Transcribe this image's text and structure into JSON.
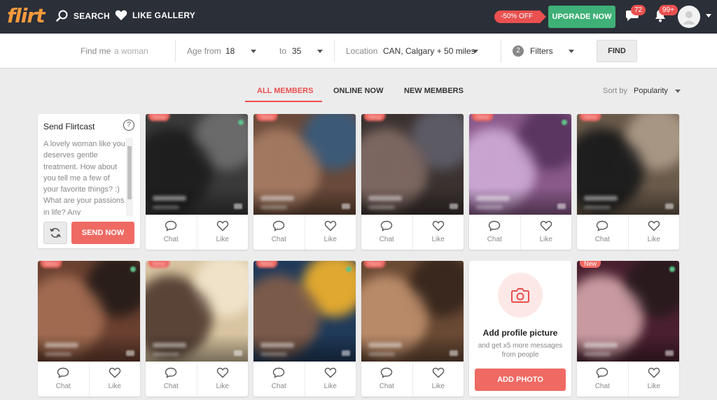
{
  "header": {
    "logo_text": "flirt",
    "nav": [
      {
        "label": "SEARCH",
        "icon": "search-icon"
      },
      {
        "label": "LIKE GALLERY",
        "icon": "heart-icon"
      }
    ],
    "promo_label": "-50% OFF",
    "upgrade_label": "UPGRADE NOW",
    "messages_count": "72",
    "notifications_count": "99+"
  },
  "filters": {
    "find_me_label": "Find me",
    "find_me_placeholder": "a woman",
    "age_from_label": "Age from",
    "age_from_value": "18",
    "age_to_label": "to",
    "age_to_value": "35",
    "location_label": "Location",
    "location_value": "CAN, Calgary + 50 miles",
    "filters_count": "2",
    "filters_label": "Filters",
    "find_button": "FIND"
  },
  "tabs": [
    {
      "label": "ALL MEMBERS",
      "active": true
    },
    {
      "label": "ONLINE NOW",
      "active": false
    },
    {
      "label": "NEW MEMBERS",
      "active": false
    }
  ],
  "sort": {
    "label": "Sort by",
    "value": "Popularity"
  },
  "flirtcast": {
    "title": "Send Flirtcast",
    "help": "?",
    "message": "A lovely woman like you deserves gentle treatment. How about you tell me a few of your favorite things? :) What are your passions in life? Any",
    "send_button": "SEND NOW"
  },
  "card_actions": {
    "chat": "Chat",
    "like": "Like"
  },
  "members": [
    {
      "tag": "New",
      "online": true,
      "colors": [
        "#3a3a3a",
        "#1f1f1f",
        "#6a6a6a"
      ]
    },
    {
      "tag": "New",
      "online": false,
      "colors": [
        "#6a4a3a",
        "#a27860",
        "#3c5a78"
      ]
    },
    {
      "tag": "New",
      "online": false,
      "colors": [
        "#3b3230",
        "#7c6660",
        "#5c5a64"
      ]
    },
    {
      "tag": "New",
      "online": true,
      "colors": [
        "#8a5a8a",
        "#c8a4d0",
        "#5a3660"
      ]
    },
    {
      "tag": "New",
      "online": false,
      "colors": [
        "#6a5a4a",
        "#1e1e1e",
        "#a89684"
      ]
    },
    {
      "tag": "New",
      "online": true,
      "colors": [
        "#6a4030",
        "#a06a50",
        "#2a1e1a"
      ]
    },
    {
      "tag": "New",
      "online": false,
      "colors": [
        "#d8c4a0",
        "#5a4438",
        "#efe2c8"
      ]
    },
    {
      "tag": "New",
      "online": true,
      "colors": [
        "#203a5a",
        "#7a5a4a",
        "#e0a830"
      ]
    },
    {
      "tag": "New",
      "online": false,
      "colors": [
        "#6a4a34",
        "#b88a68",
        "#3a281e"
      ]
    },
    {
      "tag": "New",
      "online": true,
      "colors": [
        "#4a2030",
        "#c89aa0",
        "#2a1a1e"
      ]
    }
  ],
  "add_photo": {
    "title": "Add profile picture",
    "subtitle": "and get x5 more messages from people",
    "button": "ADD PHOTO"
  },
  "colors": {
    "accent": "#ef6a63",
    "upgrade": "#3fb077",
    "topbar": "#2b2f38"
  }
}
